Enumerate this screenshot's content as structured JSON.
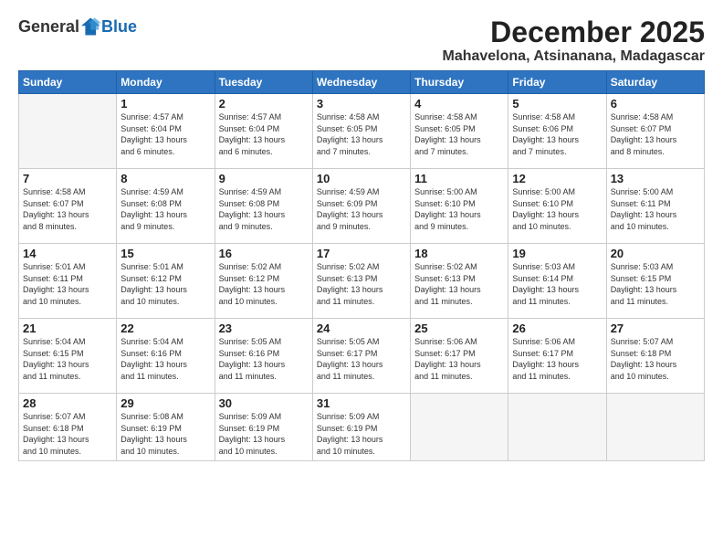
{
  "logo": {
    "general": "General",
    "blue": "Blue"
  },
  "title": "December 2025",
  "subtitle": "Mahavelona, Atsinanana, Madagascar",
  "days_header": [
    "Sunday",
    "Monday",
    "Tuesday",
    "Wednesday",
    "Thursday",
    "Friday",
    "Saturday"
  ],
  "weeks": [
    [
      {
        "day": "",
        "info": ""
      },
      {
        "day": "1",
        "info": "Sunrise: 4:57 AM\nSunset: 6:04 PM\nDaylight: 13 hours\nand 6 minutes."
      },
      {
        "day": "2",
        "info": "Sunrise: 4:57 AM\nSunset: 6:04 PM\nDaylight: 13 hours\nand 6 minutes."
      },
      {
        "day": "3",
        "info": "Sunrise: 4:58 AM\nSunset: 6:05 PM\nDaylight: 13 hours\nand 7 minutes."
      },
      {
        "day": "4",
        "info": "Sunrise: 4:58 AM\nSunset: 6:05 PM\nDaylight: 13 hours\nand 7 minutes."
      },
      {
        "day": "5",
        "info": "Sunrise: 4:58 AM\nSunset: 6:06 PM\nDaylight: 13 hours\nand 7 minutes."
      },
      {
        "day": "6",
        "info": "Sunrise: 4:58 AM\nSunset: 6:07 PM\nDaylight: 13 hours\nand 8 minutes."
      }
    ],
    [
      {
        "day": "7",
        "info": "Sunrise: 4:58 AM\nSunset: 6:07 PM\nDaylight: 13 hours\nand 8 minutes."
      },
      {
        "day": "8",
        "info": "Sunrise: 4:59 AM\nSunset: 6:08 PM\nDaylight: 13 hours\nand 9 minutes."
      },
      {
        "day": "9",
        "info": "Sunrise: 4:59 AM\nSunset: 6:08 PM\nDaylight: 13 hours\nand 9 minutes."
      },
      {
        "day": "10",
        "info": "Sunrise: 4:59 AM\nSunset: 6:09 PM\nDaylight: 13 hours\nand 9 minutes."
      },
      {
        "day": "11",
        "info": "Sunrise: 5:00 AM\nSunset: 6:10 PM\nDaylight: 13 hours\nand 9 minutes."
      },
      {
        "day": "12",
        "info": "Sunrise: 5:00 AM\nSunset: 6:10 PM\nDaylight: 13 hours\nand 10 minutes."
      },
      {
        "day": "13",
        "info": "Sunrise: 5:00 AM\nSunset: 6:11 PM\nDaylight: 13 hours\nand 10 minutes."
      }
    ],
    [
      {
        "day": "14",
        "info": "Sunrise: 5:01 AM\nSunset: 6:11 PM\nDaylight: 13 hours\nand 10 minutes."
      },
      {
        "day": "15",
        "info": "Sunrise: 5:01 AM\nSunset: 6:12 PM\nDaylight: 13 hours\nand 10 minutes."
      },
      {
        "day": "16",
        "info": "Sunrise: 5:02 AM\nSunset: 6:12 PM\nDaylight: 13 hours\nand 10 minutes."
      },
      {
        "day": "17",
        "info": "Sunrise: 5:02 AM\nSunset: 6:13 PM\nDaylight: 13 hours\nand 11 minutes."
      },
      {
        "day": "18",
        "info": "Sunrise: 5:02 AM\nSunset: 6:13 PM\nDaylight: 13 hours\nand 11 minutes."
      },
      {
        "day": "19",
        "info": "Sunrise: 5:03 AM\nSunset: 6:14 PM\nDaylight: 13 hours\nand 11 minutes."
      },
      {
        "day": "20",
        "info": "Sunrise: 5:03 AM\nSunset: 6:15 PM\nDaylight: 13 hours\nand 11 minutes."
      }
    ],
    [
      {
        "day": "21",
        "info": "Sunrise: 5:04 AM\nSunset: 6:15 PM\nDaylight: 13 hours\nand 11 minutes."
      },
      {
        "day": "22",
        "info": "Sunrise: 5:04 AM\nSunset: 6:16 PM\nDaylight: 13 hours\nand 11 minutes."
      },
      {
        "day": "23",
        "info": "Sunrise: 5:05 AM\nSunset: 6:16 PM\nDaylight: 13 hours\nand 11 minutes."
      },
      {
        "day": "24",
        "info": "Sunrise: 5:05 AM\nSunset: 6:17 PM\nDaylight: 13 hours\nand 11 minutes."
      },
      {
        "day": "25",
        "info": "Sunrise: 5:06 AM\nSunset: 6:17 PM\nDaylight: 13 hours\nand 11 minutes."
      },
      {
        "day": "26",
        "info": "Sunrise: 5:06 AM\nSunset: 6:17 PM\nDaylight: 13 hours\nand 11 minutes."
      },
      {
        "day": "27",
        "info": "Sunrise: 5:07 AM\nSunset: 6:18 PM\nDaylight: 13 hours\nand 10 minutes."
      }
    ],
    [
      {
        "day": "28",
        "info": "Sunrise: 5:07 AM\nSunset: 6:18 PM\nDaylight: 13 hours\nand 10 minutes."
      },
      {
        "day": "29",
        "info": "Sunrise: 5:08 AM\nSunset: 6:19 PM\nDaylight: 13 hours\nand 10 minutes."
      },
      {
        "day": "30",
        "info": "Sunrise: 5:09 AM\nSunset: 6:19 PM\nDaylight: 13 hours\nand 10 minutes."
      },
      {
        "day": "31",
        "info": "Sunrise: 5:09 AM\nSunset: 6:19 PM\nDaylight: 13 hours\nand 10 minutes."
      },
      {
        "day": "",
        "info": ""
      },
      {
        "day": "",
        "info": ""
      },
      {
        "day": "",
        "info": ""
      }
    ]
  ]
}
